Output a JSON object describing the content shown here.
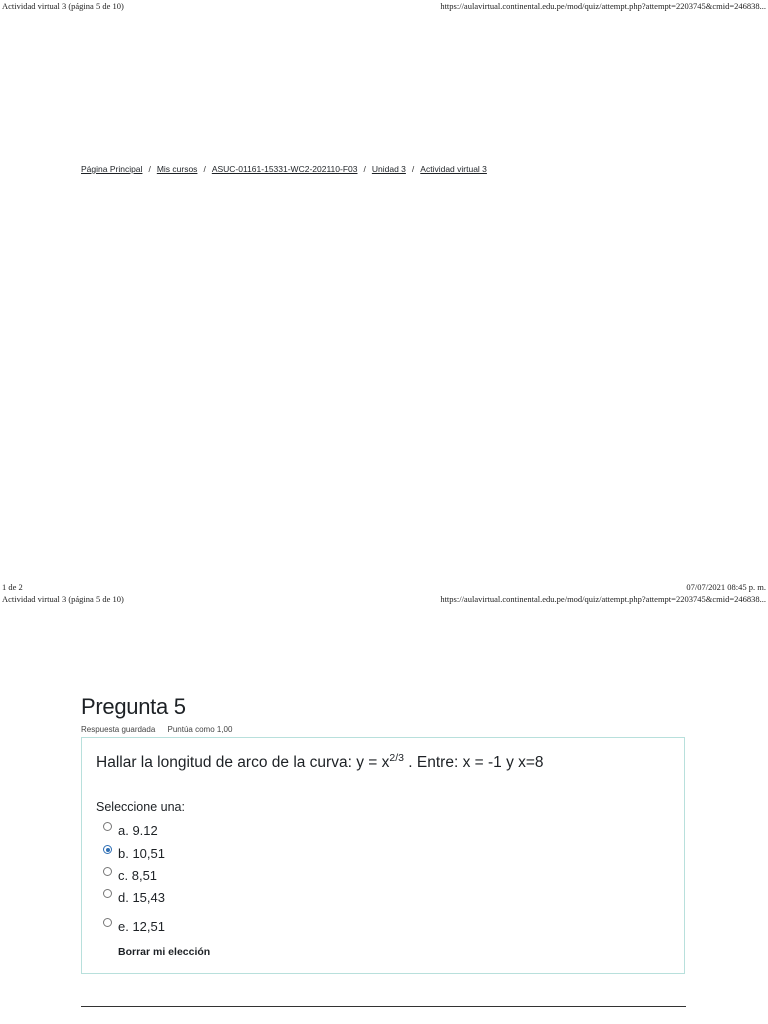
{
  "page1_header": {
    "title": "Actividad virtual 3 (página 5 de 10)",
    "url": "https://aulavirtual.continental.edu.pe/mod/quiz/attempt.php?attempt=2203745&cmid=246838..."
  },
  "breadcrumb": [
    "Página Principal",
    "Mis cursos",
    "ASUC-01161-15331-WC2-202110-F03",
    "Unidad 3",
    "Actividad virtual 3"
  ],
  "page1_footer": {
    "page_count": "1 de 2",
    "datetime": "07/07/2021 08:45 p. m."
  },
  "page2_header": {
    "title": "Actividad virtual 3 (página 5 de 10)",
    "url": "https://aulavirtual.continental.edu.pe/mod/quiz/attempt.php?attempt=2203745&cmid=246838..."
  },
  "question": {
    "title": "Pregunta 5",
    "status": "Respuesta guardada",
    "points": "Puntúa como 1,00",
    "text_before": "Hallar la longitud de arco de la curva: y = x",
    "exponent": "2/3",
    "text_after": " .  Entre:  x = -1  y  x=8",
    "prompt": "Seleccione una:",
    "options": [
      {
        "label": "a. 9.12",
        "selected": false
      },
      {
        "label": "b. 10,51",
        "selected": true
      },
      {
        "label": "c. 8,51",
        "selected": false
      },
      {
        "label": "d. 15,43",
        "selected": false
      },
      {
        "label": "e. 12,51",
        "selected": false
      }
    ],
    "clear_label": "Borrar mi elección"
  },
  "colors": {
    "box_border": "#b8e0dc",
    "radio_selected": "#2f6fb5"
  }
}
